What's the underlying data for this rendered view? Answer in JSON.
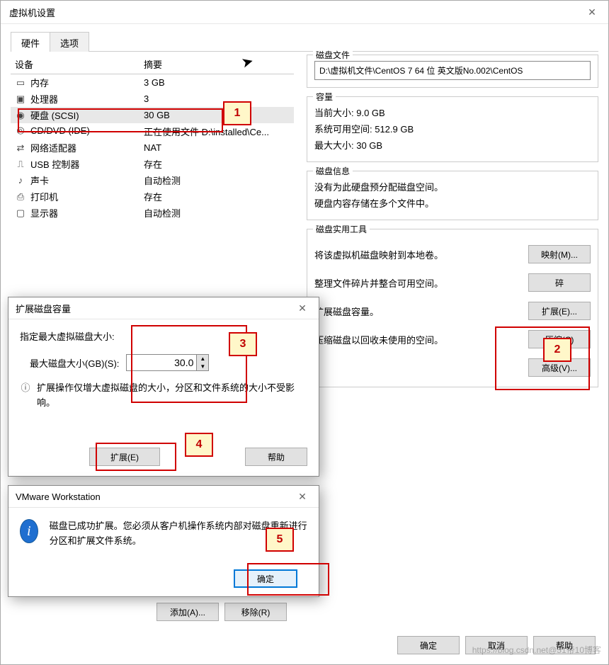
{
  "window": {
    "title": "虚拟机设置"
  },
  "tabs": {
    "hardware": "硬件",
    "options": "选项"
  },
  "columns": {
    "device": "设备",
    "summary": "摘要"
  },
  "devices": [
    {
      "icon": "memory-icon",
      "name": "内存",
      "summary": "3 GB"
    },
    {
      "icon": "cpu-icon",
      "name": "处理器",
      "summary": "3"
    },
    {
      "icon": "disk-icon",
      "name": "硬盘 (SCSI)",
      "summary": "30 GB"
    },
    {
      "icon": "cd-icon",
      "name": "CD/DVD (IDE)",
      "summary": "正在使用文件 D:\\installed\\Ce..."
    },
    {
      "icon": "nic-icon",
      "name": "网络适配器",
      "summary": "NAT"
    },
    {
      "icon": "usb-icon",
      "name": "USB 控制器",
      "summary": "存在"
    },
    {
      "icon": "sound-icon",
      "name": "声卡",
      "summary": "自动检测"
    },
    {
      "icon": "printer-icon",
      "name": "打印机",
      "summary": "存在"
    },
    {
      "icon": "display-icon",
      "name": "显示器",
      "summary": "自动检测"
    }
  ],
  "disk_file": {
    "label": "磁盘文件",
    "path": "D:\\虚拟机文件\\CentOS 7 64 位 英文版No.002\\CentOS"
  },
  "capacity": {
    "label": "容量",
    "current": "当前大小: 9.0 GB",
    "free": "系统可用空间: 512.9 GB",
    "max": "最大大小: 30 GB"
  },
  "disk_info": {
    "label": "磁盘信息",
    "line1": "没有为此硬盘预分配磁盘空间。",
    "line2": "硬盘内容存储在多个文件中。"
  },
  "tools": {
    "label": "磁盘实用工具",
    "map_desc": "将该虚拟机磁盘映射到本地卷。",
    "map_btn": "映射(M)...",
    "defrag_desc": "整理文件碎片并整合可用空间。",
    "defrag_btn": "碎",
    "expand_desc": "扩展磁盘容量。",
    "expand_btn": "扩展(E)...",
    "compact_desc": "压缩磁盘以回收未使用的空间。",
    "compact_btn": "压缩(C)",
    "advanced_btn": "高级(V)..."
  },
  "hw_buttons": {
    "add": "添加(A)...",
    "remove": "移除(R)"
  },
  "bottom": {
    "ok": "确定",
    "cancel": "取消",
    "help": "帮助"
  },
  "expand_dialog": {
    "title": "扩展磁盘容量",
    "prompt": "指定最大虚拟磁盘大小:",
    "size_label": "最大磁盘大小(GB)(S):",
    "size_value": "30.0",
    "note": "扩展操作仅增大虚拟磁盘的大小，分区和文件系统的大小不受影响。",
    "expand_btn": "扩展(E)",
    "help_btn": "帮助"
  },
  "msg_dialog": {
    "title": "VMware Workstation",
    "text": "磁盘已成功扩展。您必须从客户机操作系统内部对磁盘重新进行分区和扩展文件系统。",
    "ok": "确定"
  },
  "callouts": {
    "c1": "1",
    "c2": "2",
    "c3": "3",
    "c4": "4",
    "c5": "5"
  },
  "watermark": "https://blog.csdn.net@51帝10博客"
}
